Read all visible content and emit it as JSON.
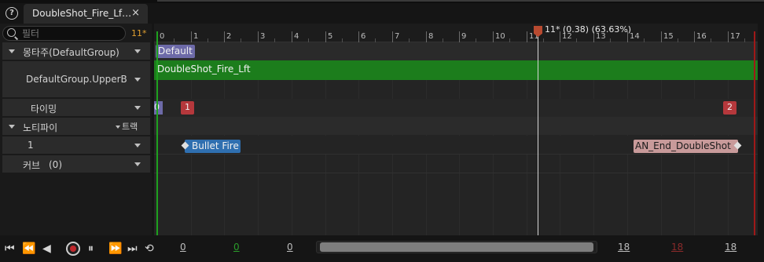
{
  "tab": {
    "title": "DoubleShot_Fire_Lf…",
    "close": "×"
  },
  "help": "?",
  "search": {
    "placeholder": "필터",
    "frame_badge": "11*"
  },
  "rows": {
    "montage": "몽타주(DefaultGroup)",
    "slot": "DefaultGroup.UpperB",
    "timing": "타이밍",
    "notify": "노티파이",
    "track_btn": "트랙",
    "notify_track": "1",
    "curves": "커브",
    "curves_count": "(0)"
  },
  "timeline": {
    "ticks": [
      "0",
      "1",
      "2",
      "3",
      "4",
      "5",
      "6",
      "7",
      "8",
      "9",
      "10",
      "11",
      "12",
      "13",
      "14",
      "15",
      "16",
      "17"
    ],
    "playhead_label": "11* (0.38) (63.63%)",
    "section_label": "Default",
    "slot_clip": "DoubleShot_Fire_Lft",
    "timing_markers": [
      "0",
      "1",
      "2"
    ],
    "notify_start": "Bullet Fire",
    "notify_end": "AN_End_DoubleShot"
  },
  "bottom": {
    "start_frame": "0",
    "in_frame": "0",
    "current": "0",
    "end_a": "18",
    "end_red": "18",
    "end_b": "18"
  },
  "colors": {
    "accent_green": "#1c7d1c",
    "marker_red": "#b5383c",
    "notify_blue": "#2f6fb0",
    "notify_pink": "#c89a9a",
    "section_purple": "#6d6aa8"
  }
}
